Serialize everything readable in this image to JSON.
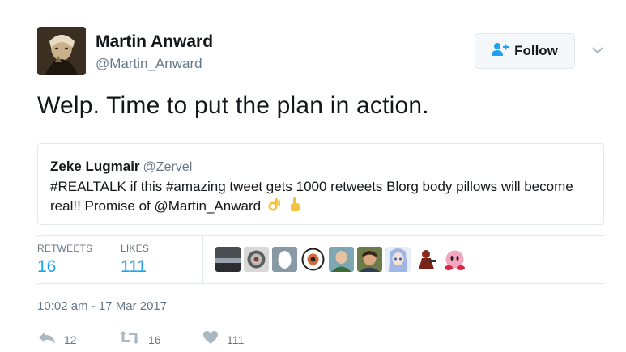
{
  "author": {
    "name": "Martin Anward",
    "handle": "@Martin_Anward"
  },
  "follow": {
    "label": "Follow"
  },
  "tweet": {
    "text": "Welp. Time to put the plan in action."
  },
  "quoted": {
    "name": "Zeke Lugmair",
    "handle": "@Zervel",
    "text_line1": "#REALTALK if this #amazing tweet gets 1000 retweets Blorg body pillows will become",
    "text_line2": "real!! Promise of @Martin_Anward",
    "emojis": [
      "ok-hand-emoji",
      "point-up-emoji"
    ]
  },
  "stats": {
    "retweets_label": "RETWEETS",
    "retweets_value": "16",
    "likes_label": "LIKES",
    "likes_value": "111"
  },
  "likers": [
    "liker-avatar-1",
    "liker-avatar-2",
    "liker-avatar-3",
    "liker-avatar-4",
    "liker-avatar-5",
    "liker-avatar-6",
    "liker-avatar-7",
    "liker-avatar-8",
    "liker-avatar-9"
  ],
  "timestamp": "10:02 am - 17 Mar 2017",
  "actions": {
    "reply_count": "12",
    "retweet_count": "16",
    "like_count": "111"
  },
  "colors": {
    "accent": "#1da1f2",
    "muted": "#657786",
    "border": "#e1e8ed",
    "icon": "#aab8c2"
  }
}
